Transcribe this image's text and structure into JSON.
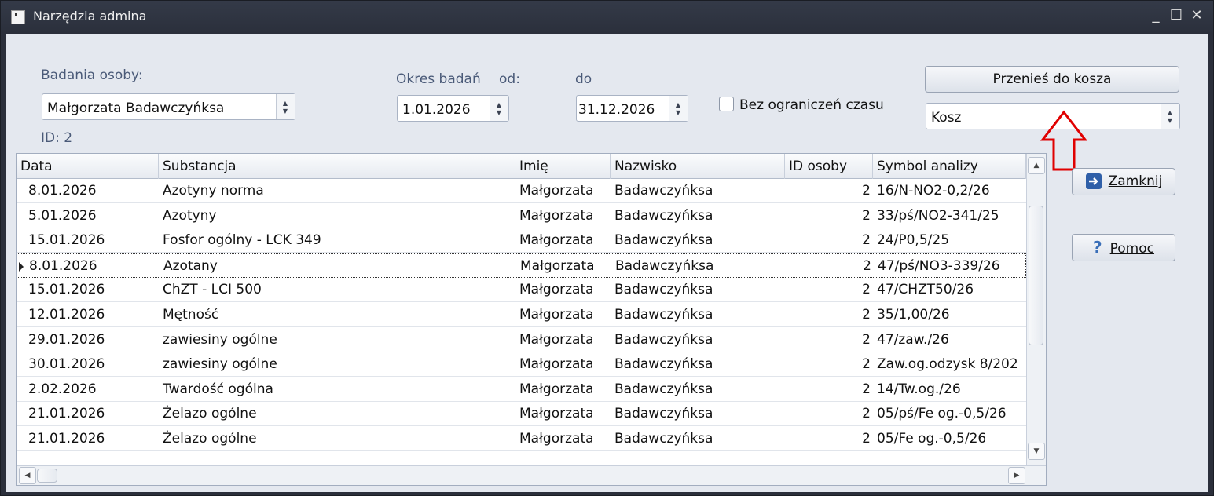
{
  "window": {
    "title": "Narzędzia admina"
  },
  "filters": {
    "person_label": "Badania osoby:",
    "person_value": "Małgorzata Badawczyńksa",
    "person_id": "ID: 2",
    "period_label": "Okres badań",
    "from_label": "od:",
    "to_label": "do",
    "date_from": "1.01.2026",
    "date_to": "31.12.2026",
    "no_time_limit_label": "Bez ograniczeń czasu",
    "no_time_limit_checked": false
  },
  "actions": {
    "move_to_trash": "Przenieś do kosza",
    "target_value": "Kosz",
    "close": "Zamknij",
    "help": "Pomoc"
  },
  "colors": {
    "annotation_arrow": "#e00000"
  },
  "table": {
    "columns": [
      "Data",
      "Substancja",
      "Imię",
      "Nazwisko",
      "ID osoby",
      "Symbol analizy"
    ],
    "current_row": 3,
    "rows": [
      [
        "8.01.2026",
        "Azotyny norma",
        "Małgorzata",
        "Badawczyńksa",
        "2",
        "16/N-NO2-0,2/26"
      ],
      [
        "5.01.2026",
        "Azotyny",
        "Małgorzata",
        "Badawczyńksa",
        "2",
        "33/pś/NO2-341/25"
      ],
      [
        "15.01.2026",
        "Fosfor ogólny - LCK 349",
        "Małgorzata",
        "Badawczyńksa",
        "2",
        "24/P0,5/25"
      ],
      [
        "8.01.2026",
        "Azotany",
        "Małgorzata",
        "Badawczyńksa",
        "2",
        "47/pś/NO3-339/26"
      ],
      [
        "15.01.2026",
        "ChZT - LCI 500",
        "Małgorzata",
        "Badawczyńksa",
        "2",
        "47/CHZT50/26"
      ],
      [
        "12.01.2026",
        "Mętność",
        "Małgorzata",
        "Badawczyńksa",
        "2",
        "35/1,00/26"
      ],
      [
        "29.01.2026",
        "zawiesiny ogólne",
        "Małgorzata",
        "Badawczyńksa",
        "2",
        "47/zaw./26"
      ],
      [
        "30.01.2026",
        "zawiesiny ogólne",
        "Małgorzata",
        "Badawczyńksa",
        "2",
        "Zaw.og.odzysk 8/202"
      ],
      [
        "2.02.2026",
        "Twardość ogólna",
        "Małgorzata",
        "Badawczyńksa",
        "2",
        "14/Tw.og./26"
      ],
      [
        "21.01.2026",
        "Żelazo ogólne",
        "Małgorzata",
        "Badawczyńksa",
        "2",
        "05/pś/Fe og.-0,5/26"
      ],
      [
        "21.01.2026",
        "Żelazo ogólne",
        "Małgorzata",
        "Badawczyńksa",
        "2",
        "05/Fe og.-0,5/26"
      ]
    ]
  }
}
